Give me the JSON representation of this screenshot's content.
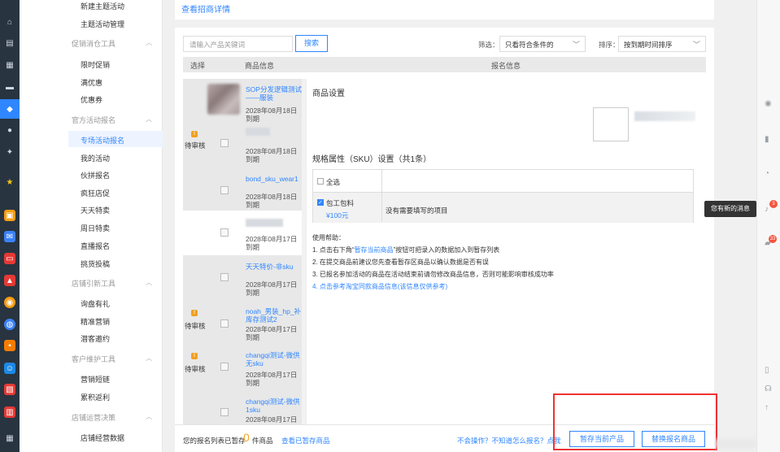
{
  "rail": {
    "icons": [
      "home-icon",
      "clipboard-icon",
      "list-icon",
      "card-icon",
      "tag-icon",
      "user-icon",
      "share-icon",
      "star-icon",
      "app-icon",
      "mail-icon",
      "shop-icon",
      "chart-icon",
      "coupon-icon",
      "globe-icon",
      "gift-icon",
      "people-icon",
      "ticket-icon",
      "service-icon",
      "grid-icon"
    ],
    "active_color": "#2f86ff"
  },
  "menu": {
    "items": [
      {
        "label": "新建主题活动",
        "type": "item"
      },
      {
        "label": "主题活动管理",
        "type": "item"
      },
      {
        "label": "促销消仓工具",
        "type": "group"
      },
      {
        "label": "限时促销",
        "type": "item"
      },
      {
        "label": "满优惠",
        "type": "item"
      },
      {
        "label": "优惠券",
        "type": "item"
      },
      {
        "label": "官方活动报名",
        "type": "group"
      },
      {
        "label": "专场活动报名",
        "type": "item",
        "active": true
      },
      {
        "label": "我的活动",
        "type": "item"
      },
      {
        "label": "伙拼报名",
        "type": "item"
      },
      {
        "label": "疯狂店促",
        "type": "item"
      },
      {
        "label": "天天特卖",
        "type": "item"
      },
      {
        "label": "周日特卖",
        "type": "item"
      },
      {
        "label": "直播报名",
        "type": "item"
      },
      {
        "label": "挑货投稿",
        "type": "item"
      },
      {
        "label": "店铺引新工具",
        "type": "group"
      },
      {
        "label": "询盘有礼",
        "type": "item"
      },
      {
        "label": "精准营销",
        "type": "item"
      },
      {
        "label": "潜客邀约",
        "type": "item"
      },
      {
        "label": "客户维护工具",
        "type": "group"
      },
      {
        "label": "营销短链",
        "type": "item"
      },
      {
        "label": "累积返利",
        "type": "item"
      },
      {
        "label": "店铺运营决策",
        "type": "group"
      },
      {
        "label": "店铺经营数据",
        "type": "item"
      }
    ]
  },
  "header": {
    "link": "查看招商详情"
  },
  "search": {
    "placeholder": "请输入产品关键词",
    "button": "搜索"
  },
  "filter": {
    "label": "筛选：",
    "value": "只看符合条件的",
    "sort_label": "排序：",
    "sort_value": "按到期时间排序"
  },
  "table": {
    "col_select": "选择",
    "col_product": "商品信息",
    "col_signup": "报名信息"
  },
  "products": [
    {
      "status": "",
      "name": "SOP分发逻辑测试——服装",
      "date": "2028年08月18日到期",
      "selected": true
    },
    {
      "status": "待审核",
      "name": "",
      "date": "2028年08月18日到期",
      "selected": false
    },
    {
      "status": "",
      "name": "bond_sku_wear1",
      "date": "2028年08月18日到期",
      "selected": false
    },
    {
      "status": "",
      "name": "",
      "date": "2028年08月17日到期",
      "selected": false
    },
    {
      "status": "",
      "name": "天天特价-非sku",
      "date": "2028年08月17日到期",
      "selected": false
    },
    {
      "status": "待审核",
      "name": "noah_男装_hp_补库存测试2",
      "date": "2028年08月17日到期",
      "selected": false
    },
    {
      "status": "待审核",
      "name": "changqi测试-微供无sku",
      "date": "2028年08月17日到期",
      "selected": false
    },
    {
      "status": "",
      "name": "changqi测试-微供1sku",
      "date": "2028年08月17日",
      "selected": false
    }
  ],
  "detail": {
    "goods_setting": "商品设置",
    "sku_title": "规格属性（SKU）设置（共1条）",
    "select_all": "全选",
    "sku_name": "包工包料",
    "sku_price": "¥100元",
    "sku_note": "没有需要填写的项目",
    "help_title": "使用帮助：",
    "help_1a": "1. 点击右下角“",
    "help_1b": "暂存当前商品",
    "help_1c": "”按钮可把录入的数据加入到暂存列表",
    "help_2": "2. 在提交商品前建议您先查看暂存区商品以确认数据是否有误",
    "help_3": "3. 已报名参加活动的商品在活动结束前请勿修改商品信息，否则可能影响审核成功率",
    "help_4": "4. 点击参考淘宝同款商品信息(该信息仅供参考)"
  },
  "bottom": {
    "text_before": "您的报名列表已暂存",
    "count": "0",
    "text_after": "件商品",
    "view_link": "查看已暂存商品",
    "confused": "不会操作？不知道怎么报名？点我",
    "btn_save": "暂存当前产品",
    "btn_replace": "替换报名商品"
  },
  "right_rail": {
    "tooltip": "您有新的消息",
    "badge_1": "3",
    "badge_2": "33",
    "top_arrow": "↑"
  }
}
